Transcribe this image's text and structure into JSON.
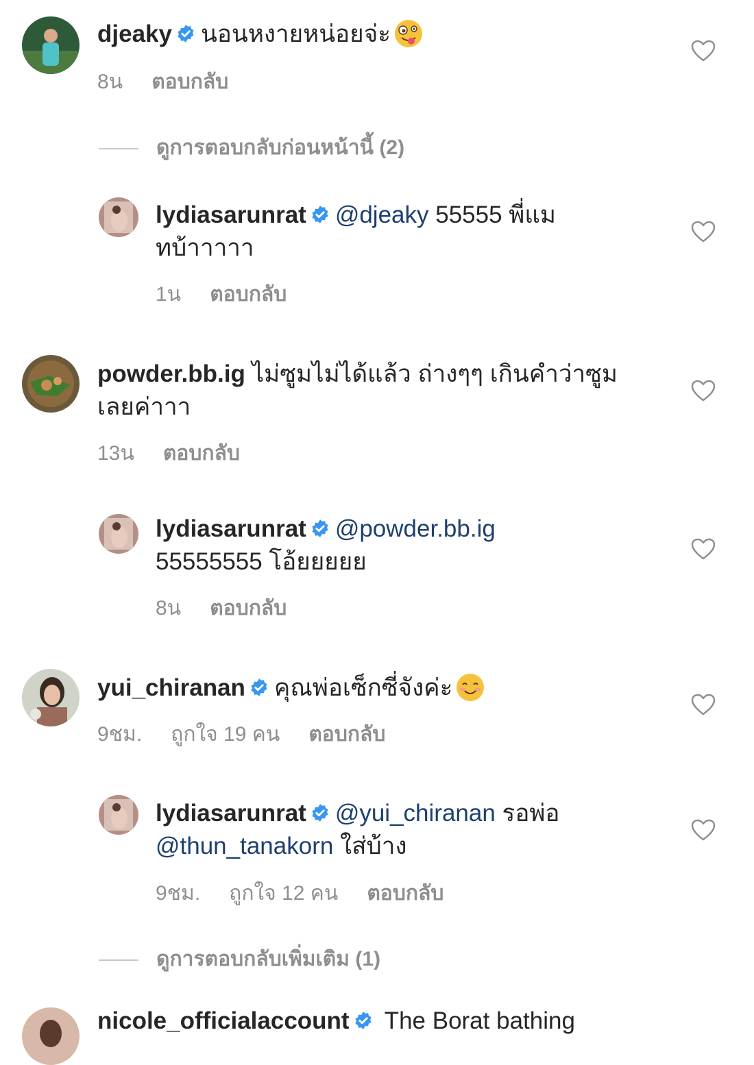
{
  "verified_color": "#3897f0",
  "mention_color": "#1d3f6e",
  "meta_color": "#8e8e8e",
  "comments": [
    {
      "user": "djeaky",
      "text": "นอนหงายหน่อยจ่ะ",
      "emoji": "zany-face-emoji",
      "time": "8น",
      "reply": "ตอบกลับ"
    },
    {
      "view_prev": "ดูการตอบกลับก่อนหน้านี้ (2)"
    },
    {
      "user": "lydiasarunrat",
      "mention": "@djeaky",
      "text_line1": " 55555 พี่แม",
      "text_line2": "ทบ้าาาาา",
      "time": "1น",
      "reply": "ตอบกลับ"
    },
    {
      "user": "powder.bb.ig",
      "text_line1": " ไม่ซูมไม่ได้แล้ว ถ่างๆๆ เกินคำว่าซูม",
      "text_line2": "เลยค่าาา",
      "time": "13น",
      "reply": "ตอบกลับ"
    },
    {
      "user": "lydiasarunrat",
      "mention": "@powder.bb.ig",
      "text_line2": "55555555 โอ้ยยยยย",
      "time": "8น",
      "reply": "ตอบกลับ"
    },
    {
      "user": "yui_chiranan",
      "text": "คุณพ่อเซ็กซี่จังค่ะ",
      "emoji": "smiling-face-emoji",
      "time": "9ชม.",
      "likes": "ถูกใจ 19 คน",
      "reply": "ตอบกลับ"
    },
    {
      "user": "lydiasarunrat",
      "mention": "@yui_chiranan",
      "text_line1": " รอพ่อ",
      "mention2": "@thun_tanakorn",
      "text_line2": " ใส่บ้าง",
      "time": "9ชม.",
      "likes": "ถูกใจ 12 คน",
      "reply": "ตอบกลับ"
    },
    {
      "view_more": "ดูการตอบกลับเพิ่มเติม (1)"
    },
    {
      "user": "nicole_officialaccount",
      "text": " The Borat bathing"
    }
  ]
}
